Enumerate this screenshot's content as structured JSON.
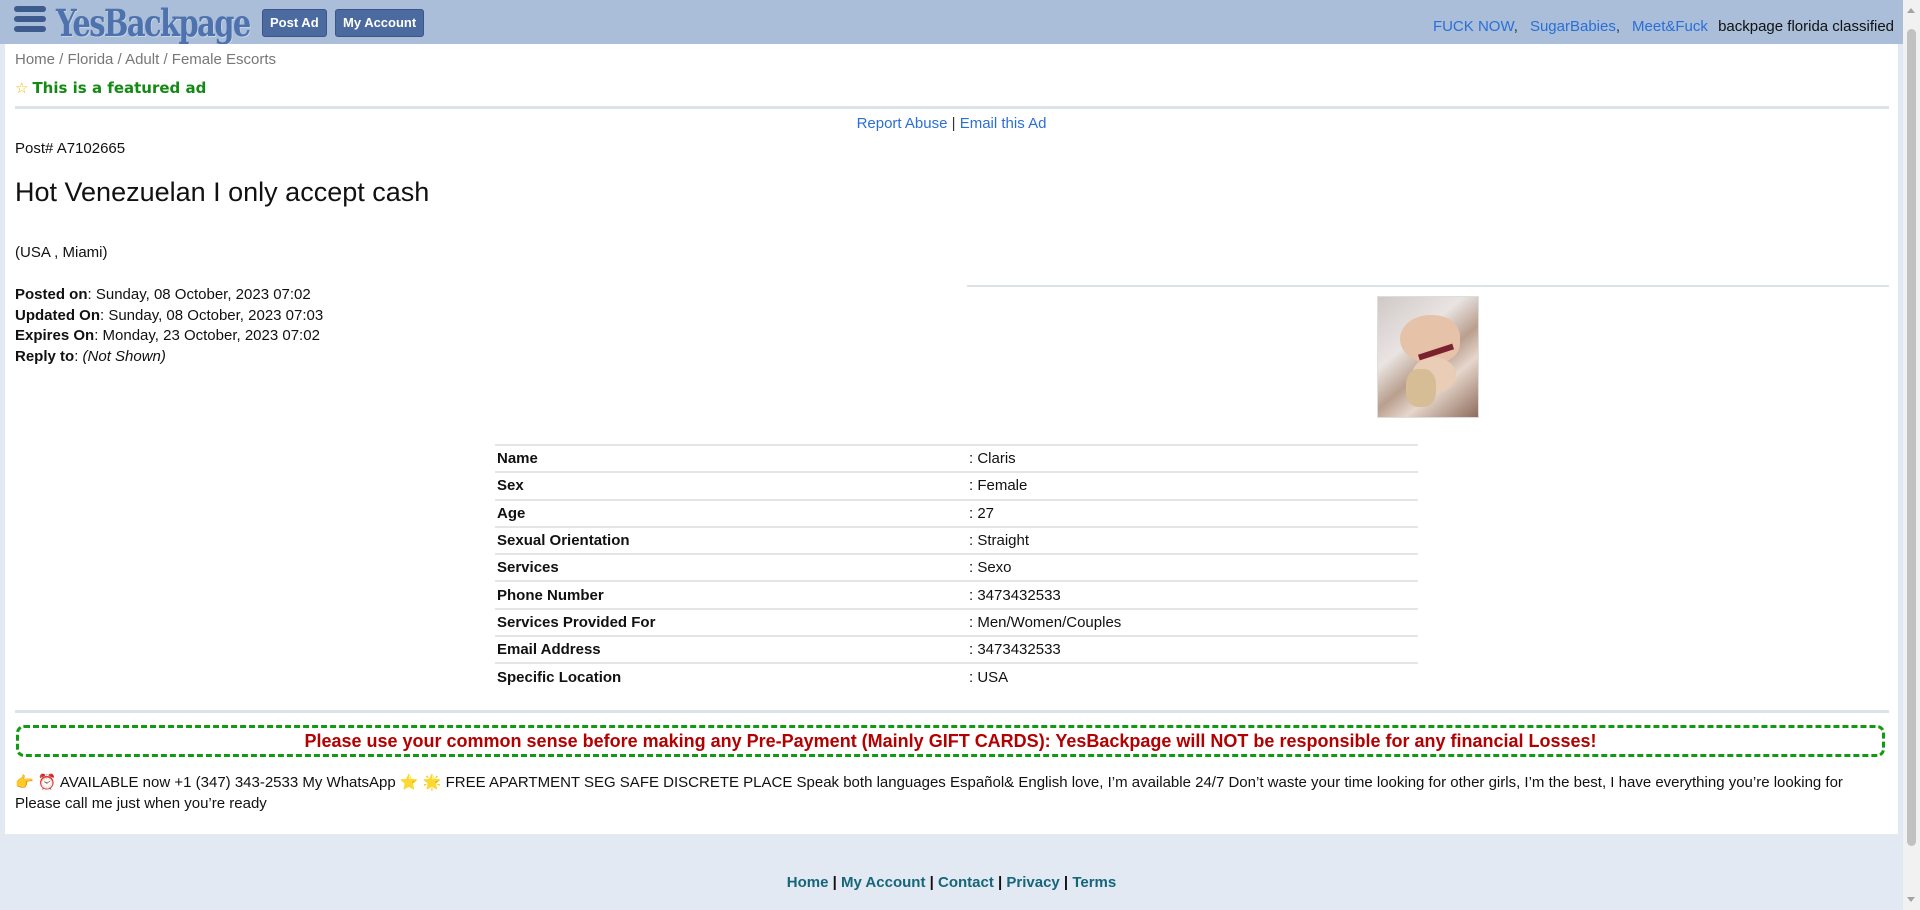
{
  "header": {
    "logo": "YesBackpage",
    "post_ad": "Post Ad",
    "my_account": "My Account",
    "links": [
      "FUCK NOW",
      "SugarBabies",
      "Meet&Fuck"
    ],
    "tagline": "backpage florida classified"
  },
  "breadcrumb": {
    "home": "Home",
    "state": "Florida",
    "category": "Adult",
    "subcategory": "Female Escorts"
  },
  "featured_label": "This is a featured ad",
  "actions": {
    "report": "Report Abuse",
    "email": "Email this Ad",
    "separator": "|"
  },
  "post_number": "Post# A7102665",
  "title": "Hot Venezuelan I only accept cash",
  "location": "(USA , Miami)",
  "meta": [
    {
      "label": "Posted on",
      "value": ": Sunday, 08 October, 2023  07:02"
    },
    {
      "label": "Updated On",
      "value": ": Sunday, 08 October, 2023  07:03"
    },
    {
      "label": "Expires On",
      "value": ": Monday, 23 October, 2023  07:02"
    },
    {
      "label": "Reply to",
      "value": ":",
      "note": "(Not Shown)"
    }
  ],
  "details": [
    {
      "key": "Name",
      "value": ": Claris"
    },
    {
      "key": "Sex",
      "value": ": Female"
    },
    {
      "key": "Age",
      "value": ": 27"
    },
    {
      "key": "Sexual Orientation",
      "value": ": Straight"
    },
    {
      "key": "Services",
      "value": ": Sexo"
    },
    {
      "key": "Phone Number",
      "value": ": 3473432533"
    },
    {
      "key": "Services Provided For",
      "value": ": Men/Women/Couples"
    },
    {
      "key": "Email Address",
      "value": ": 3473432533"
    },
    {
      "key": "Specific Location",
      "value": ": USA"
    }
  ],
  "warning": "Please use your common sense before making any Pre-Payment (Mainly GIFT CARDS): YesBackpage will NOT be responsible for any financial Losses!",
  "description": "👉 ⏰ AVAILABLE now +1 (347) 343-2533 My WhatsApp ⭐ 🌟 FREE APARTMENT SEG SAFE DISCRETE PLACE Speak both languages Español& English love, I’m available 24/7 Don’t waste your time looking for other girls, I’m the best, I have everything you’re looking for Please call me just when you’re ready",
  "footer": [
    "Home",
    "My Account",
    "Contact",
    "Privacy",
    "Terms"
  ]
}
